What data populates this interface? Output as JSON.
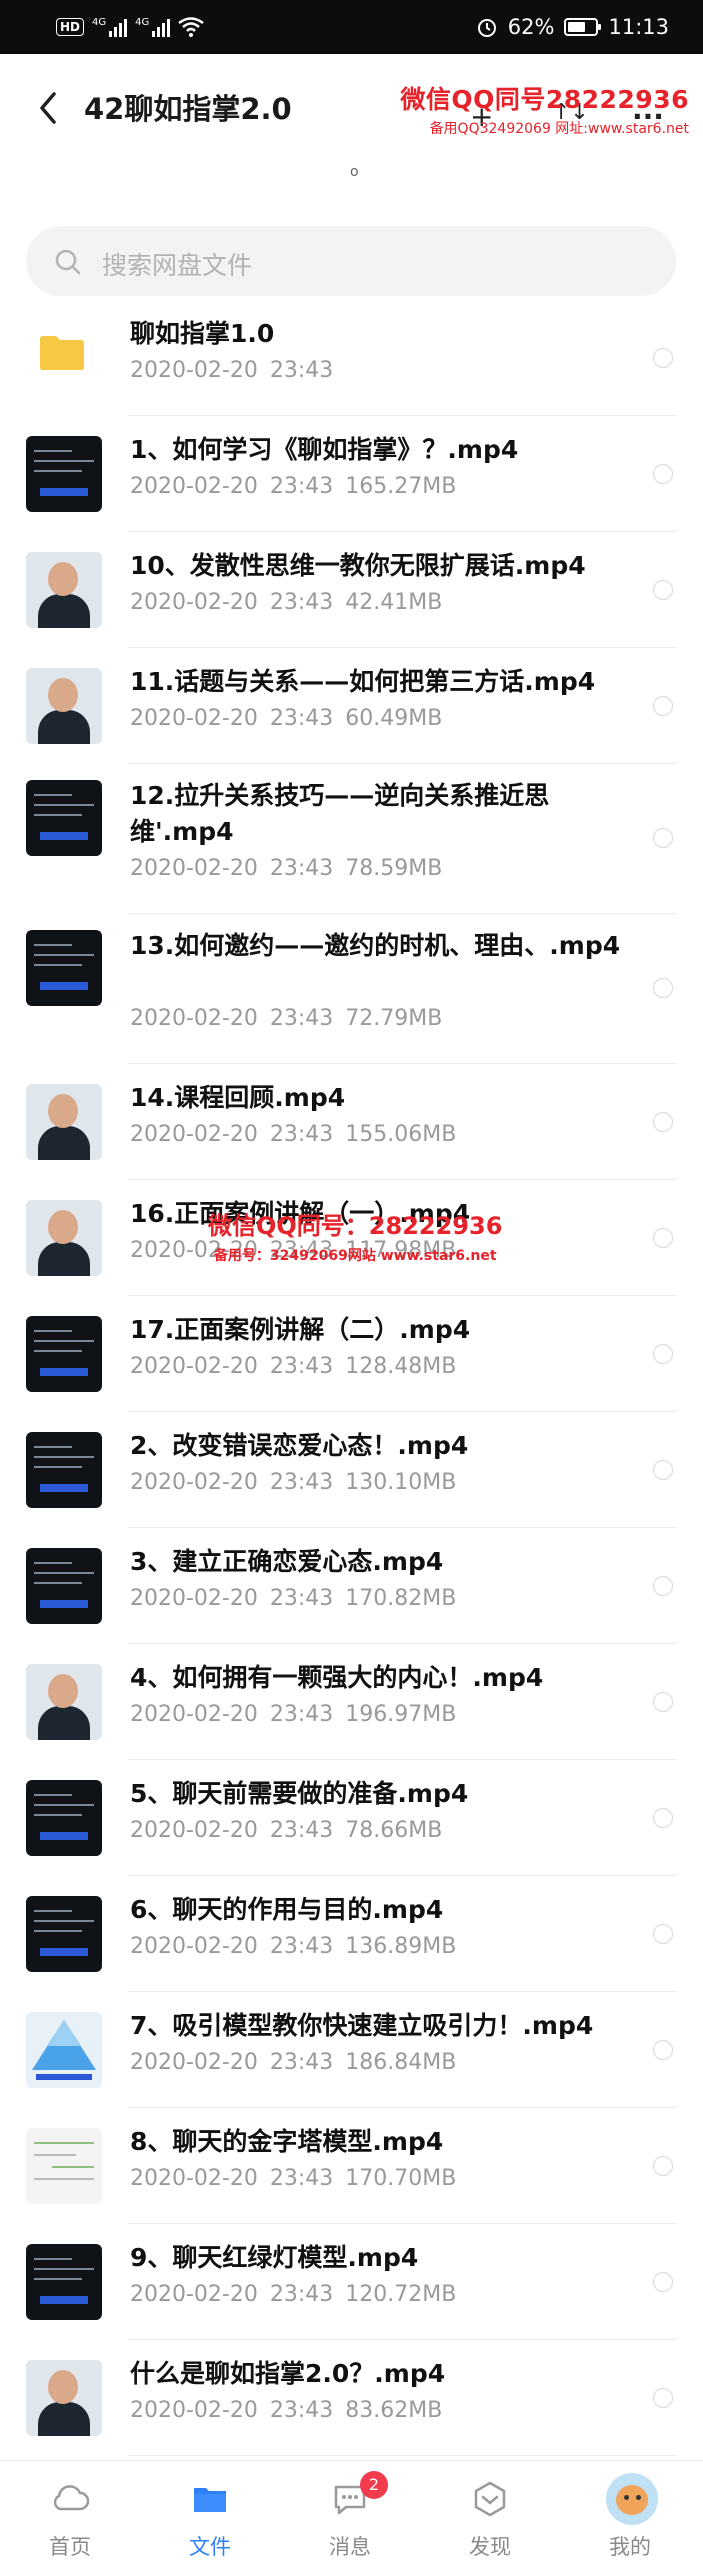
{
  "status_bar": {
    "hd": "HD",
    "net1": "4G",
    "net2": "4G",
    "battery_text": "62%",
    "battery_level": 0.62,
    "time": "11:13"
  },
  "header": {
    "title": "42聊如指掌2.0",
    "back_icon": "back-arrow-icon",
    "add_icon": "+",
    "sort_icon": "↑↓",
    "more_icon": "···"
  },
  "watermark_top": {
    "line1": "微信QQ同号28222936",
    "line2": "备用QQ32492069 网址:www.star6.net"
  },
  "watermark_middle": {
    "line1": "微信QQ同号：28222936",
    "line2": "备用号：32492069网站 www.star6.net"
  },
  "tiny_mark": "o",
  "search": {
    "placeholder": "搜索网盘文件"
  },
  "files": [
    {
      "name": "聊如指掌1.0",
      "date": "2020-02-20",
      "time": "23:43",
      "size": "",
      "type": "folder"
    },
    {
      "name": "1、如何学习《聊如指掌》？.mp4",
      "date": "2020-02-20",
      "time": "23:43",
      "size": "165.27MB",
      "type": "video-dark"
    },
    {
      "name": "10、发散性思维一教你无限扩展话.mp4",
      "date": "2020-02-20",
      "time": "23:43",
      "size": "42.41MB",
      "type": "video-person"
    },
    {
      "name": "11.话题与关系——如何把第三方话.mp4",
      "date": "2020-02-20",
      "time": "23:43",
      "size": "60.49MB",
      "type": "video-person"
    },
    {
      "name": "12.拉升关系技巧——逆向关系推近思维'.mp4",
      "date": "2020-02-20",
      "time": "23:43",
      "size": "78.59MB",
      "type": "video-dark"
    },
    {
      "name": "13.如何邀约——邀约的时机、理由、.mp4",
      "date": "2020-02-20",
      "time": "23:43",
      "size": "72.79MB",
      "type": "video-dark"
    },
    {
      "name": "14.课程回顾.mp4",
      "date": "2020-02-20",
      "time": "23:43",
      "size": "155.06MB",
      "type": "video-person"
    },
    {
      "name": "16.正面案例讲解（一）.mp4",
      "date": "2020-02-20",
      "time": "23:43",
      "size": "117.98MB",
      "type": "video-person"
    },
    {
      "name": "17.正面案例讲解（二）.mp4",
      "date": "2020-02-20",
      "time": "23:43",
      "size": "128.48MB",
      "type": "video-dark"
    },
    {
      "name": "2、改变错误恋爱心态！.mp4",
      "date": "2020-02-20",
      "time": "23:43",
      "size": "130.10MB",
      "type": "video-dark"
    },
    {
      "name": "3、建立正确恋爱心态.mp4",
      "date": "2020-02-20",
      "time": "23:43",
      "size": "170.82MB",
      "type": "video-dark"
    },
    {
      "name": "4、如何拥有一颗强大的内心！.mp4",
      "date": "2020-02-20",
      "time": "23:43",
      "size": "196.97MB",
      "type": "video-person"
    },
    {
      "name": "5、聊天前需要做的准备.mp4",
      "date": "2020-02-20",
      "time": "23:43",
      "size": "78.66MB",
      "type": "video-dark"
    },
    {
      "name": "6、聊天的作用与目的.mp4",
      "date": "2020-02-20",
      "time": "23:43",
      "size": "136.89MB",
      "type": "video-dark"
    },
    {
      "name": "7、吸引模型教你快速建立吸引力！.mp4",
      "date": "2020-02-20",
      "time": "23:43",
      "size": "186.84MB",
      "type": "video-pyramid"
    },
    {
      "name": "8、聊天的金字塔模型.mp4",
      "date": "2020-02-20",
      "time": "23:43",
      "size": "170.70MB",
      "type": "video-chat"
    },
    {
      "name": "9、聊天红绿灯模型.mp4",
      "date": "2020-02-20",
      "time": "23:43",
      "size": "120.72MB",
      "type": "video-dark"
    },
    {
      "name": "什么是聊如指掌2.0？.mp4",
      "date": "2020-02-20",
      "time": "23:43",
      "size": "83.62MB",
      "type": "video-person"
    }
  ],
  "tabbar": {
    "tabs": [
      {
        "label": "首页",
        "icon": "cloud-icon"
      },
      {
        "label": "文件",
        "icon": "folder-icon"
      },
      {
        "label": "消息",
        "icon": "message-icon",
        "badge": "2"
      },
      {
        "label": "发现",
        "icon": "discover-icon"
      },
      {
        "label": "我的",
        "icon": "avatar-icon"
      }
    ],
    "active": "文件"
  },
  "colors": {
    "accent": "#2f7ff5",
    "watermark": "#e6222a",
    "badge": "#f23b4c",
    "folder": "#f6c844"
  }
}
